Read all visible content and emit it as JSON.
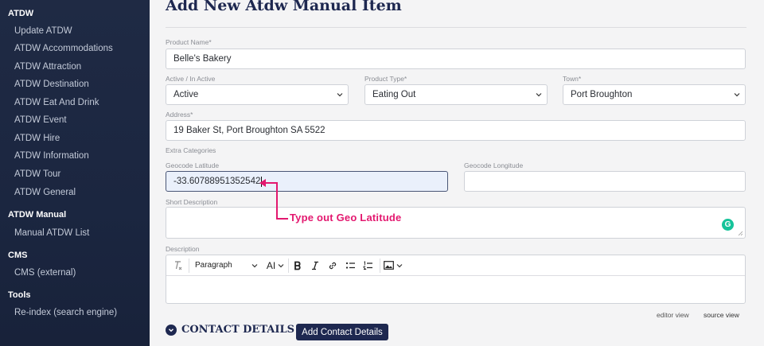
{
  "sidebar": {
    "sections": [
      {
        "heading": "ATDW",
        "items": [
          "Update ATDW",
          "ATDW Accommodations",
          "ATDW Attraction",
          "ATDW Destination",
          "ATDW Eat And Drink",
          "ATDW Event",
          "ATDW Hire",
          "ATDW Information",
          "ATDW Tour",
          "ATDW General"
        ]
      },
      {
        "heading": "ATDW Manual",
        "items": [
          "Manual ATDW List"
        ]
      },
      {
        "heading": "CMS",
        "items": [
          "CMS (external)"
        ]
      },
      {
        "heading": "Tools",
        "items": [
          "Re-index (search engine)"
        ]
      }
    ]
  },
  "page": {
    "title": "Add New Atdw Manual Item"
  },
  "form": {
    "product_name_label": "Product Name*",
    "product_name_value": "Belle's Bakery",
    "active_label": "Active / In Active",
    "active_value": "Active",
    "product_type_label": "Product Type*",
    "product_type_value": "Eating Out",
    "town_label": "Town*",
    "town_value": "Port Broughton",
    "address_label": "Address*",
    "address_value": "19 Baker St, Port Broughton SA 5522",
    "extra_categories_label": "Extra Categories",
    "geo_lat_label": "Geocode Latitude",
    "geo_lat_value": "-33.60788951352542",
    "geo_long_label": "Geocode Longitude",
    "geo_long_value": "",
    "short_desc_label": "Short Description",
    "description_label": "Description"
  },
  "editor": {
    "paragraph_label": "Paragraph",
    "ai_label": "AI",
    "editor_view": "editor view",
    "source_view": "source view"
  },
  "annotation": {
    "text": "Type out Geo Latitude",
    "color": "#e3186f"
  },
  "contact": {
    "title": "CONTACT DETAILS",
    "button": "Add Contact Details"
  },
  "colors": {
    "sidebar_bg": "#1f2a44",
    "primary": "#1e2850",
    "accent": "#e3186f",
    "grammarly": "#15c39a"
  },
  "icons": {
    "grammarly": "grammarly-icon",
    "collapse": "chevron-down-circle-icon"
  }
}
